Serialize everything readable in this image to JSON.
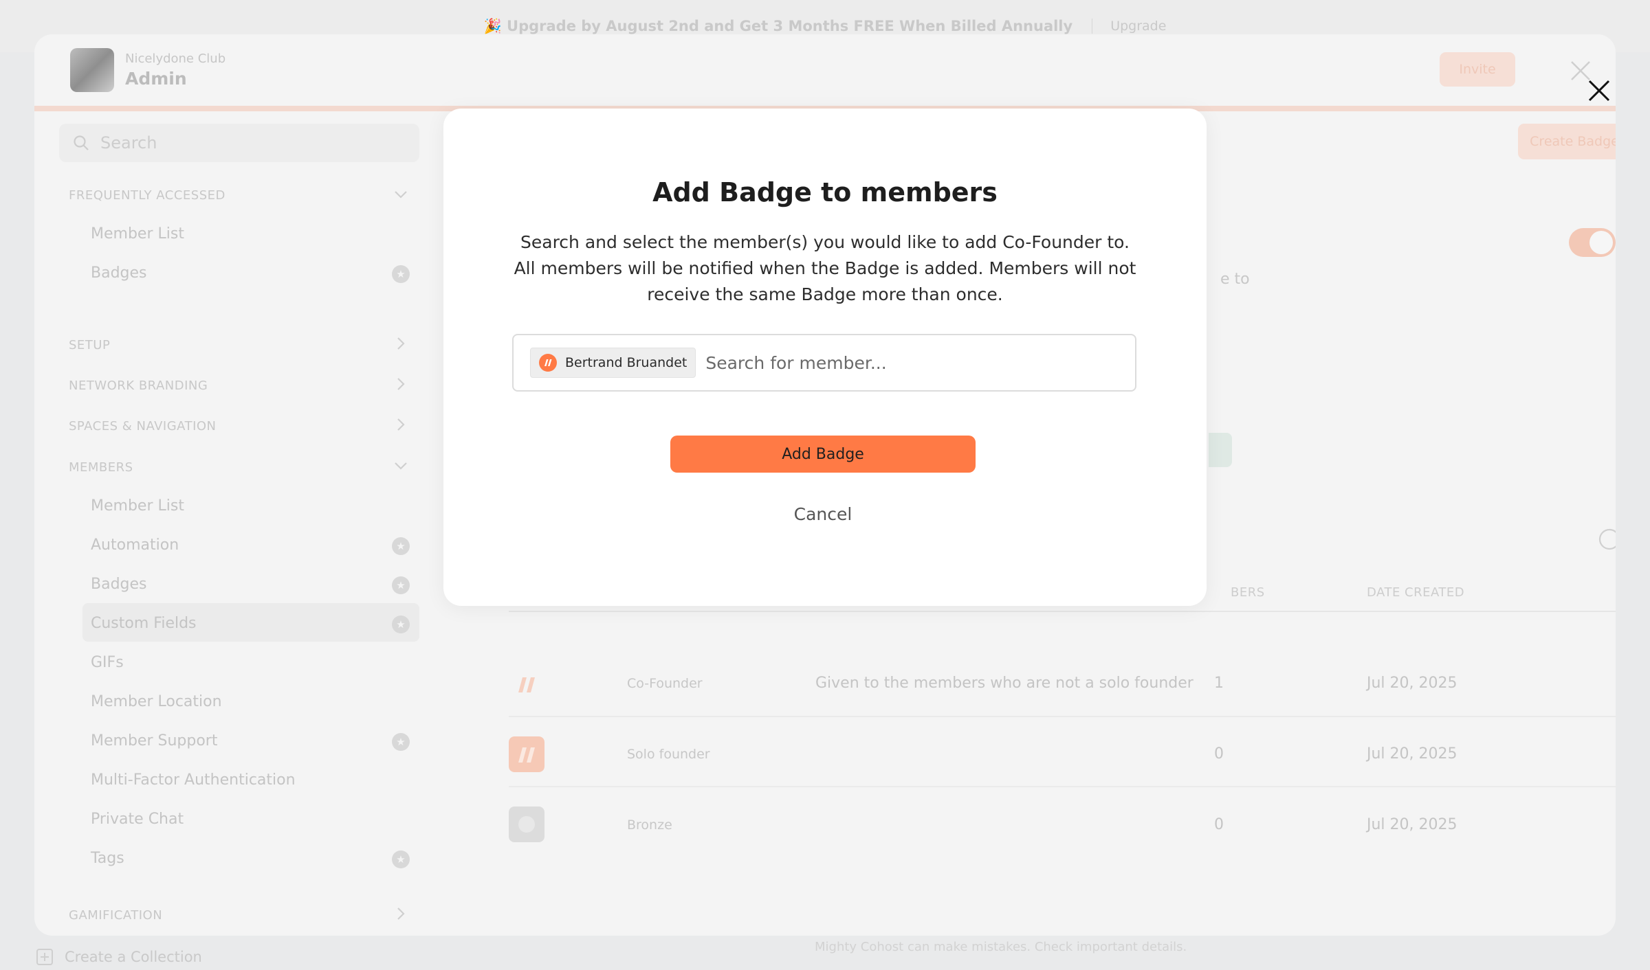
{
  "banner": {
    "text": "🎉 Upgrade by August 2nd and Get 3 Months FREE When Billed Annually",
    "button": "Upgrade"
  },
  "admin": {
    "club_name": "Nicelydone Club",
    "role": "Admin",
    "invite_label": "Invite"
  },
  "sidebar": {
    "search_placeholder": "Search",
    "sections": [
      {
        "title": "FREQUENTLY ACCESSED",
        "items": [
          "Member List",
          "Badges"
        ]
      },
      {
        "title": "SETUP"
      },
      {
        "title": "NETWORK BRANDING"
      },
      {
        "title": "SPACES & NAVIGATION"
      },
      {
        "title": "MEMBERS",
        "items": [
          "Member List",
          "Automation",
          "Badges",
          "Custom Fields",
          "GIFs",
          "Member Location",
          "Member Support",
          "Multi-Factor Authentication",
          "Private Chat",
          "Tags"
        ]
      },
      {
        "title": "GAMIFICATION"
      }
    ],
    "create_collection": "Create a Collection"
  },
  "main": {
    "create_badge_label": "Create Badge",
    "ghost_text": "e to",
    "table_headers": [
      "BERS",
      "DATE CREATED"
    ],
    "rows": [
      {
        "name": "Co-Founder",
        "description": "Given to the members who are not a solo founder",
        "members": "1",
        "date": "Jul 20, 2025"
      },
      {
        "name": "Solo founder",
        "description": "",
        "members": "0",
        "date": "Jul 20, 2025"
      },
      {
        "name": "Bronze",
        "description": "",
        "members": "0",
        "date": "Jul 20, 2025"
      }
    ],
    "footer_note": "Mighty Cohost can make mistakes. Check important details."
  },
  "modal": {
    "title": "Add Badge to members",
    "description": "Search and select the member(s) you would like to add Co-Founder to. All members will be notified when the Badge is added. Members will not receive the same Badge more than once.",
    "selected_member": "Bertrand Bruandet",
    "search_placeholder": "Search for member...",
    "add_button": "Add Badge",
    "cancel_button": "Cancel"
  },
  "colors": {
    "accent": "#ff7a45",
    "accent_faded": "#f6dfd6"
  }
}
